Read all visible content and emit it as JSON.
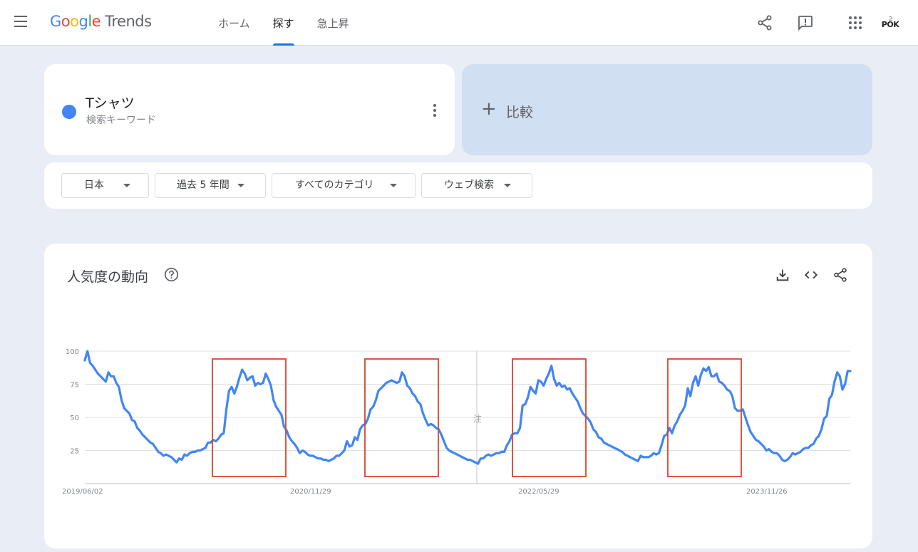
{
  "header": {
    "logo_parts": [
      "G",
      "o",
      "o",
      "g",
      "l",
      "e"
    ],
    "logo_trends": "Trends",
    "nav": [
      {
        "label": "ホーム",
        "active": false
      },
      {
        "label": "探す",
        "active": true
      },
      {
        "label": "急上昇",
        "active": false
      }
    ],
    "avatar_text": "POK",
    "avatar_sup": "2"
  },
  "term": {
    "name": "Tシャツ",
    "subtitle": "検索キーワード",
    "color": "#4285f4"
  },
  "compare": {
    "plus": "+",
    "label": "比較"
  },
  "filters": {
    "region": "日本",
    "period": "過去 5 年間",
    "category": "すべてのカテゴリ",
    "search_type": "ウェブ検索"
  },
  "chart_card": {
    "title": "人気度の動向",
    "note_marker": "注"
  },
  "chart_data": {
    "type": "line",
    "title": "人気度の動向",
    "ylim": [
      0,
      100
    ],
    "y_ticks": [
      "100",
      "75",
      "50",
      "25"
    ],
    "x_ticks": [
      "2019/06/02",
      "2020/11/29",
      "2022/05/29",
      "2023/11/26"
    ],
    "x_range": [
      "2019/05/26",
      "2024/05/19"
    ],
    "grid": true,
    "series": [
      {
        "color": "#4285f4",
        "values": [
          93,
          100,
          91,
          89,
          86,
          83,
          81,
          79,
          77,
          84,
          81,
          81,
          76,
          73,
          63,
          57,
          55,
          53,
          48,
          47,
          42,
          40,
          37,
          35,
          33,
          31,
          30,
          27,
          24,
          23,
          21,
          22,
          21,
          20,
          18,
          16,
          19,
          18,
          22,
          21,
          23,
          24,
          24,
          25,
          25,
          26,
          27,
          31,
          31,
          33,
          32,
          34,
          37,
          38,
          56,
          70,
          73,
          68,
          73,
          80,
          86,
          83,
          78,
          80,
          81,
          74,
          76,
          75,
          76,
          83,
          79,
          74,
          63,
          58,
          55,
          52,
          43,
          40,
          35,
          32,
          30,
          27,
          23,
          25,
          24,
          22,
          21,
          21,
          20,
          19,
          19,
          18,
          18,
          17,
          18,
          19,
          21,
          21,
          23,
          25,
          32,
          28,
          29,
          35,
          33,
          41,
          44,
          45,
          49,
          56,
          58,
          63,
          70,
          72,
          74,
          76,
          77,
          78,
          77,
          76,
          77,
          84,
          81,
          74,
          72,
          68,
          66,
          62,
          60,
          53,
          48,
          44,
          45,
          44,
          42,
          41,
          37,
          32,
          27,
          25,
          24,
          23,
          22,
          21,
          20,
          19,
          18,
          18,
          17,
          16,
          15,
          19,
          19,
          21,
          22,
          21,
          22,
          23,
          23,
          24,
          24,
          29,
          32,
          37,
          38,
          38,
          42,
          59,
          60,
          65,
          73,
          70,
          68,
          78,
          77,
          74,
          79,
          83,
          89,
          79,
          74,
          76,
          73,
          74,
          71,
          72,
          68,
          65,
          62,
          57,
          53,
          51,
          49,
          46,
          41,
          39,
          35,
          34,
          31,
          30,
          29,
          28,
          27,
          26,
          25,
          24,
          22,
          21,
          20,
          19,
          18,
          17,
          21,
          20,
          20,
          20,
          21,
          23,
          22,
          23,
          29,
          36,
          37,
          42,
          38,
          44,
          47,
          52,
          55,
          59,
          72,
          66,
          76,
          81,
          74,
          82,
          87,
          85,
          88,
          81,
          81,
          83,
          77,
          76,
          74,
          71,
          70,
          66,
          57,
          55,
          55,
          56,
          50,
          44,
          39,
          36,
          33,
          32,
          30,
          28,
          25,
          26,
          24,
          23,
          23,
          21,
          18,
          17,
          18,
          20,
          23,
          22,
          23,
          24,
          26,
          27,
          27,
          29,
          30,
          34,
          36,
          41,
          49,
          51,
          64,
          67,
          77,
          84,
          81,
          71,
          75,
          85,
          85
        ]
      }
    ]
  }
}
